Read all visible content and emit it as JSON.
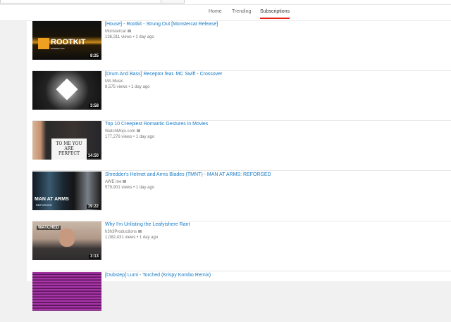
{
  "nav": {
    "tabs": [
      {
        "label": "Home"
      },
      {
        "label": "Trending"
      },
      {
        "label": "Subscriptions",
        "active": true
      }
    ]
  },
  "colors": {
    "accent": "#e62117",
    "link": "#167ac6"
  },
  "videos": [
    {
      "title": "[House] - Rootkit - Strung Out [Monstercat Release]",
      "channel": "Monstercat",
      "verified": true,
      "views": "136,311 views",
      "age": "1 day ago",
      "duration": "8:25",
      "thumb_text": "ROOTKIT",
      "thumb_subtext": "STRUNG OUT"
    },
    {
      "title": "[Drum And Bass] Receptor feat. MC Swift - Crossover",
      "channel": "MA Music",
      "verified": false,
      "views": "8,575 views",
      "age": "1 day ago",
      "duration": "3:58"
    },
    {
      "title": "Top 10 Creepiest Romantic Gestures in Movies",
      "channel": "WatchMojo.com",
      "verified": true,
      "views": "177,276 views",
      "age": "1 day ago",
      "duration": "14:50",
      "thumb_text": "TO ME YOU ARE PERFECT"
    },
    {
      "title": "Shredder's Helmet and Arms Blades (TMNT) - MAN AT ARMS: REFORGED",
      "channel": "AWE me",
      "verified": true,
      "views": "579,901 views",
      "age": "1 day ago",
      "duration": "19:22",
      "thumb_text": "MAN AT ARMS",
      "thumb_subtext": "REFORGED"
    },
    {
      "title": "Why I'm Unlisting the Leafyishere Rant",
      "channel": "h3h3Productions",
      "verified": true,
      "views": "1,082,431 views",
      "age": "1 day ago",
      "duration": "3:13",
      "watched": "WATCHED"
    },
    {
      "title": "[Dubstep] Lumi - Torched (Krispy Kombo Remix)",
      "channel": "",
      "verified": false,
      "views": "",
      "age": "",
      "duration": ""
    }
  ],
  "separator": "•"
}
